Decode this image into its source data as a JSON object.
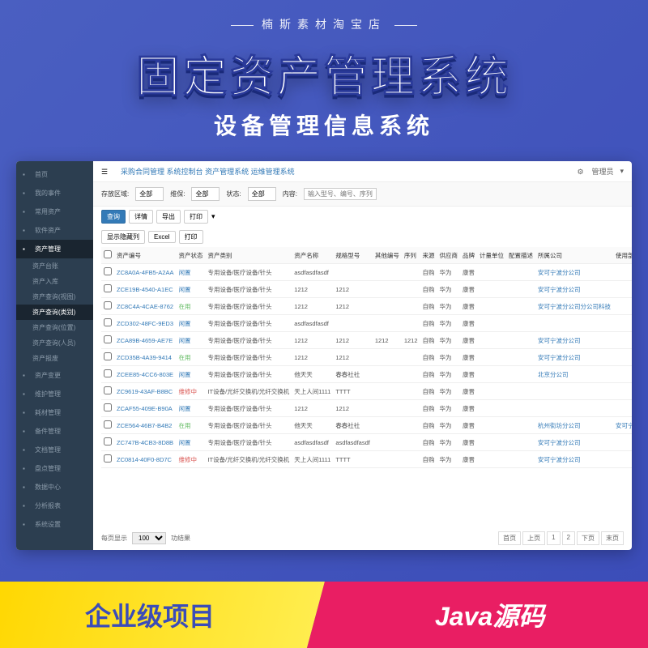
{
  "banner": {
    "shop_name": "楠斯素材淘宝店",
    "main_title": "固定资产管理系统",
    "sub_title": "设备管理信息系统",
    "bottom_left": "企业级项目",
    "bottom_right": "Java源码"
  },
  "sidebar": {
    "items": [
      {
        "label": "首页",
        "icon": "home"
      },
      {
        "label": "我的事件",
        "icon": "user"
      },
      {
        "label": "常用资产",
        "icon": "star"
      },
      {
        "label": "软件资产",
        "icon": "disk"
      },
      {
        "label": "资产管理",
        "icon": "folder",
        "active": true,
        "subs": [
          {
            "label": "资产台账"
          },
          {
            "label": "资产入库"
          },
          {
            "label": "资产查询(视图)"
          },
          {
            "label": "资产查询(类别)",
            "active": true
          },
          {
            "label": "资产查询(位置)"
          },
          {
            "label": "资产查询(人员)"
          },
          {
            "label": "资产报废"
          }
        ]
      },
      {
        "label": "资产变更",
        "icon": "swap"
      },
      {
        "label": "维护管理",
        "icon": "wrench"
      },
      {
        "label": "耗材管理",
        "icon": "box"
      },
      {
        "label": "备件管理",
        "icon": "parts"
      },
      {
        "label": "文档管理",
        "icon": "doc"
      },
      {
        "label": "盘点管理",
        "icon": "check"
      },
      {
        "label": "数据中心",
        "icon": "data"
      },
      {
        "label": "分析报表",
        "icon": "chart"
      },
      {
        "label": "系统设置",
        "icon": "gear"
      }
    ]
  },
  "topnav": {
    "items": [
      "采购合同管理",
      "系统控制台",
      "资产管理系统",
      "运维管理系统"
    ],
    "user": "管理员"
  },
  "filters": {
    "region_label": "存放区域:",
    "region_value": "全部",
    "status_label": "维保:",
    "status_value": "全部",
    "state_label": "状态:",
    "state_value": "全部",
    "content_label": "内容:",
    "content_placeholder": "输入型号、编号、序列号"
  },
  "actions": {
    "query": "查询",
    "detail": "详情",
    "export": "导出",
    "print": "打印",
    "show_cols": "显示隐藏列",
    "excel": "Excel",
    "print2": "打印"
  },
  "table": {
    "headers": [
      "",
      "资产编号",
      "资产状态",
      "资产类别",
      "资产名称",
      "规格型号",
      "其他编号",
      "序列",
      "来源",
      "供应商",
      "品牌",
      "计量单位",
      "配置描述",
      "所属公司",
      "使用部门"
    ],
    "rows": [
      {
        "id": "ZC8A0A-4FB5-A2AA",
        "status": "闲置",
        "status_cls": "idle",
        "cat": "专用设备/医疗设备/针头",
        "name": "asdfasdfasdf",
        "spec": "",
        "other": "",
        "serial": "",
        "src": "自购",
        "vendor": "华为",
        "brand": "康晋",
        "unit": "",
        "desc": "",
        "company": "安可宁波分公司",
        "dept": ""
      },
      {
        "id": "ZCE19B-4540-A1EC",
        "status": "闲置",
        "status_cls": "idle",
        "cat": "专用设备/医疗设备/针头",
        "name": "1212",
        "spec": "1212",
        "other": "",
        "serial": "",
        "src": "自购",
        "vendor": "华为",
        "brand": "康晋",
        "unit": "",
        "desc": "",
        "company": "安可宁波分公司",
        "dept": ""
      },
      {
        "id": "ZC8C4A-4CAE-8762",
        "status": "在用",
        "status_cls": "use",
        "cat": "专用设备/医疗设备/针头",
        "name": "1212",
        "spec": "1212",
        "other": "",
        "serial": "",
        "src": "自购",
        "vendor": "华为",
        "brand": "康晋",
        "unit": "",
        "desc": "",
        "company": "安可宁波分公司分公司科技",
        "dept": ""
      },
      {
        "id": "ZCD302-48FC-9ED3",
        "status": "闲置",
        "status_cls": "idle",
        "cat": "专用设备/医疗设备/针头",
        "name": "asdfasdfasdf",
        "spec": "",
        "other": "",
        "serial": "",
        "src": "自购",
        "vendor": "华为",
        "brand": "康晋",
        "unit": "",
        "desc": "",
        "company": "",
        "dept": ""
      },
      {
        "id": "ZCA89B-4659-AE7E",
        "status": "闲置",
        "status_cls": "idle",
        "cat": "专用设备/医疗设备/针头",
        "name": "1212",
        "spec": "1212",
        "other": "1212",
        "serial": "1212",
        "src": "自购",
        "vendor": "华为",
        "brand": "康晋",
        "unit": "",
        "desc": "",
        "company": "安可宁波分公司",
        "dept": ""
      },
      {
        "id": "ZCD35B-4A39-9414",
        "status": "在用",
        "status_cls": "use",
        "cat": "专用设备/医疗设备/针头",
        "name": "1212",
        "spec": "1212",
        "other": "",
        "serial": "",
        "src": "自购",
        "vendor": "华为",
        "brand": "康晋",
        "unit": "",
        "desc": "",
        "company": "安可宁波分公司",
        "dept": ""
      },
      {
        "id": "ZCEE85-4CC6-803E",
        "status": "闲置",
        "status_cls": "idle",
        "cat": "专用设备/医疗设备/针头",
        "name": "他天天",
        "spec": "春春社社",
        "other": "",
        "serial": "",
        "src": "自购",
        "vendor": "华为",
        "brand": "康晋",
        "unit": "",
        "desc": "",
        "company": "北京分公司",
        "dept": ""
      },
      {
        "id": "ZC9619-43AF-B8BC",
        "status": "维修中",
        "status_cls": "repair",
        "cat": "IT设备/光纤交换机/光纤交换机",
        "name": "天上人间1111",
        "spec": "TTTT",
        "other": "",
        "serial": "",
        "src": "自购",
        "vendor": "华为",
        "brand": "康晋",
        "unit": "",
        "desc": "",
        "company": "",
        "dept": ""
      },
      {
        "id": "ZCAF55-409E-B90A",
        "status": "闲置",
        "status_cls": "idle",
        "cat": "专用设备/医疗设备/针头",
        "name": "1212",
        "spec": "1212",
        "other": "",
        "serial": "",
        "src": "自购",
        "vendor": "华为",
        "brand": "康晋",
        "unit": "",
        "desc": "",
        "company": "",
        "dept": ""
      },
      {
        "id": "ZCE564-46B7-B4B2",
        "status": "在用",
        "status_cls": "use",
        "cat": "专用设备/医疗设备/针头",
        "name": "他天天",
        "spec": "春春社社",
        "other": "",
        "serial": "",
        "src": "自购",
        "vendor": "华为",
        "brand": "康晋",
        "unit": "",
        "desc": "",
        "company": "杭州街坊分公司",
        "dept": "安可宁波分公司科技"
      },
      {
        "id": "ZC747B-4CB3-8D8B",
        "status": "闲置",
        "status_cls": "idle",
        "cat": "专用设备/医疗设备/针头",
        "name": "asdfasdfasdf",
        "spec": "asdfasdfasdf",
        "other": "",
        "serial": "",
        "src": "自购",
        "vendor": "华为",
        "brand": "康晋",
        "unit": "",
        "desc": "",
        "company": "安可宁波分公司",
        "dept": ""
      },
      {
        "id": "ZC0814-40F0-8D7C",
        "status": "维修中",
        "status_cls": "repair",
        "cat": "IT设备/光纤交换机/光纤交换机",
        "name": "天上人间1111",
        "spec": "TTTT",
        "other": "",
        "serial": "",
        "src": "自购",
        "vendor": "华为",
        "brand": "康晋",
        "unit": "",
        "desc": "",
        "company": "安可宁波分公司",
        "dept": ""
      }
    ]
  },
  "pagination": {
    "per_page_label": "每页显示",
    "per_page_value": "100",
    "total_label": "功结果",
    "first": "首页",
    "prev": "上页",
    "p1": "1",
    "p2": "2",
    "next": "下页",
    "last": "末页"
  }
}
